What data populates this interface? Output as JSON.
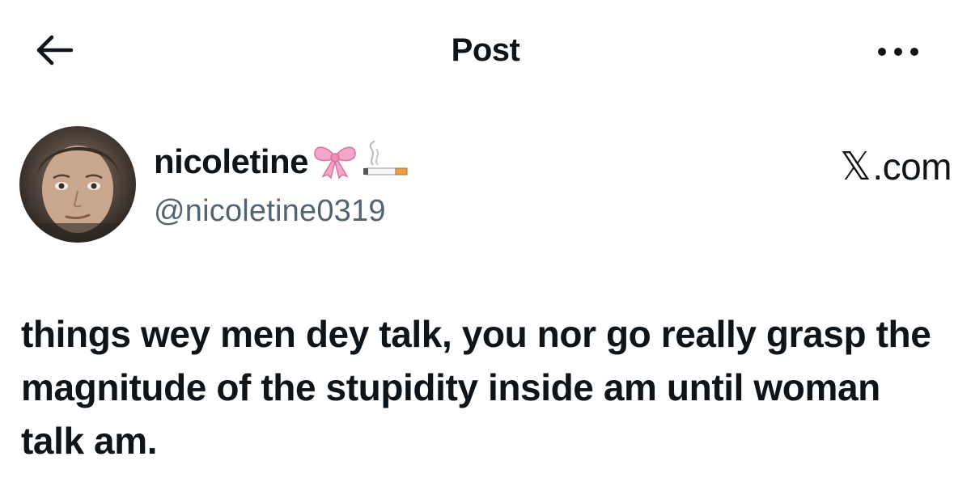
{
  "header": {
    "back_icon": "arrow-left-icon",
    "title": "Post",
    "more_icon": "more-horizontal-icon"
  },
  "author": {
    "display_name": "nicoletine",
    "name_emojis": [
      "ribbon-bow-emoji",
      "cigarette-emoji"
    ],
    "handle": "@nicoletine0319",
    "brand": ".com",
    "brand_mark": "𝕏"
  },
  "post": {
    "text": "things wey men dey talk, you nor go really grasp the magnitude of the stupidity inside am until woman talk am."
  },
  "colors": {
    "text_primary": "#0f1419",
    "text_secondary": "#536471",
    "background": "#ffffff",
    "ribbon": "#f4a6c8"
  }
}
